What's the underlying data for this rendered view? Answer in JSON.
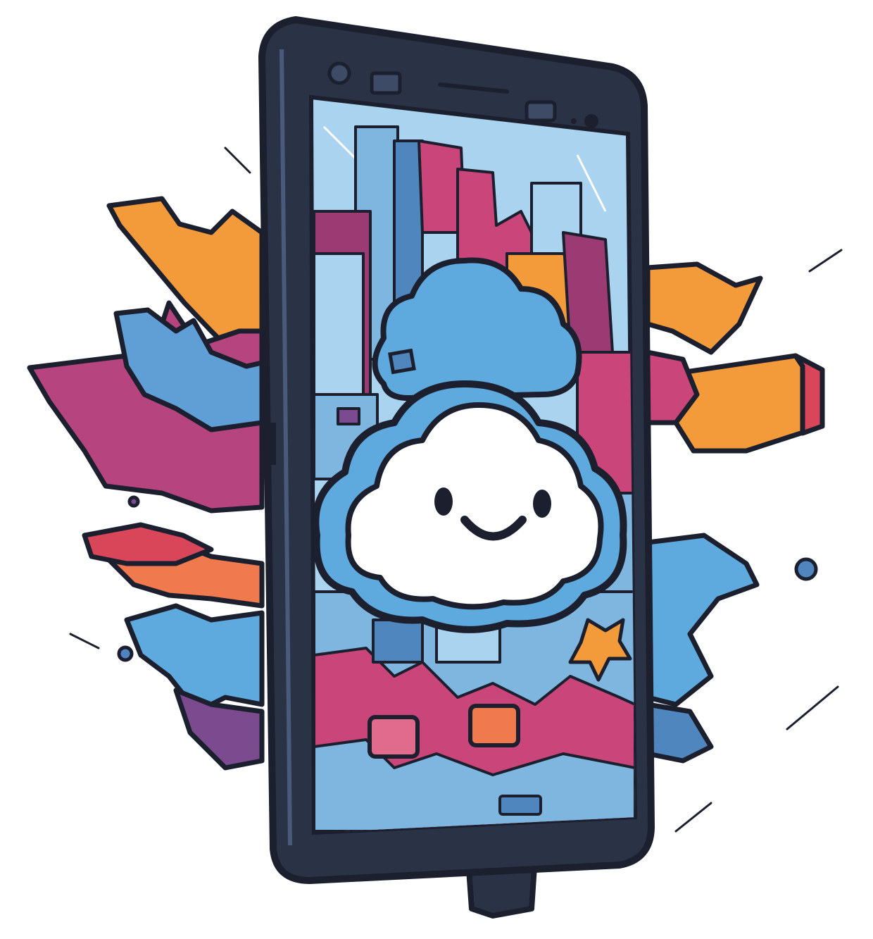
{
  "illustration": {
    "subject": "graffiti-phone-cloud-mascot",
    "background": "#ffffff"
  },
  "palette": {
    "outline": "#1b1f2e",
    "phone_body": "#2a3346",
    "phone_edge": "#3d4b66",
    "screen_sky": "#a9d3ef",
    "building_blue": "#7fb6e0",
    "building_blue_dark": "#4f86bd",
    "building_pink": "#c9457a",
    "building_magenta": "#9b3a73",
    "splash_orange": "#f39a3a",
    "splash_red": "#d9465a",
    "splash_purple": "#7b4a8f",
    "cloud_blue": "#5ea9dd",
    "cloud_white": "#ffffff",
    "pink_button": "#e06b8d",
    "orange_button": "#f07a4e"
  },
  "icons": {
    "mascot": "smiling-cloud-icon",
    "phone": "smartphone-icon",
    "front_camera": "camera-icon",
    "speaker": "speaker-grille-icon",
    "star": "star-icon"
  }
}
